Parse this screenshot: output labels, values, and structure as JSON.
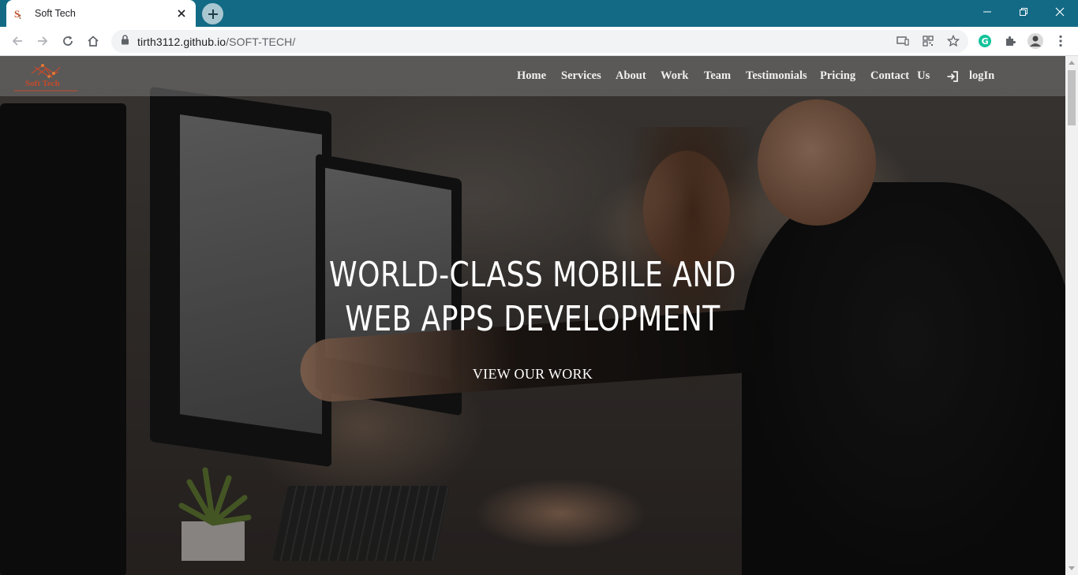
{
  "browser": {
    "tab_title": "Soft Tech",
    "url_host": "tirth3112.github.io",
    "url_path": "/SOFT-TECH/",
    "colors": {
      "tabbar": "#136a85",
      "toolbar": "#ffffff"
    }
  },
  "site": {
    "logo_text": "Soft Tech",
    "nav": {
      "home": "Home",
      "services": "Services",
      "about": "About",
      "work": "Work",
      "team": "Team",
      "testimonials": "Testimonials",
      "pricing": "Pricing",
      "contact": "Contact",
      "us": "Us",
      "login": "logIn"
    },
    "hero": {
      "line1": "WORLD-CLASS MOBILE AND",
      "line2": "WEB APPS DEVELOPMENT",
      "cta": "VIEW OUR WORK"
    }
  }
}
